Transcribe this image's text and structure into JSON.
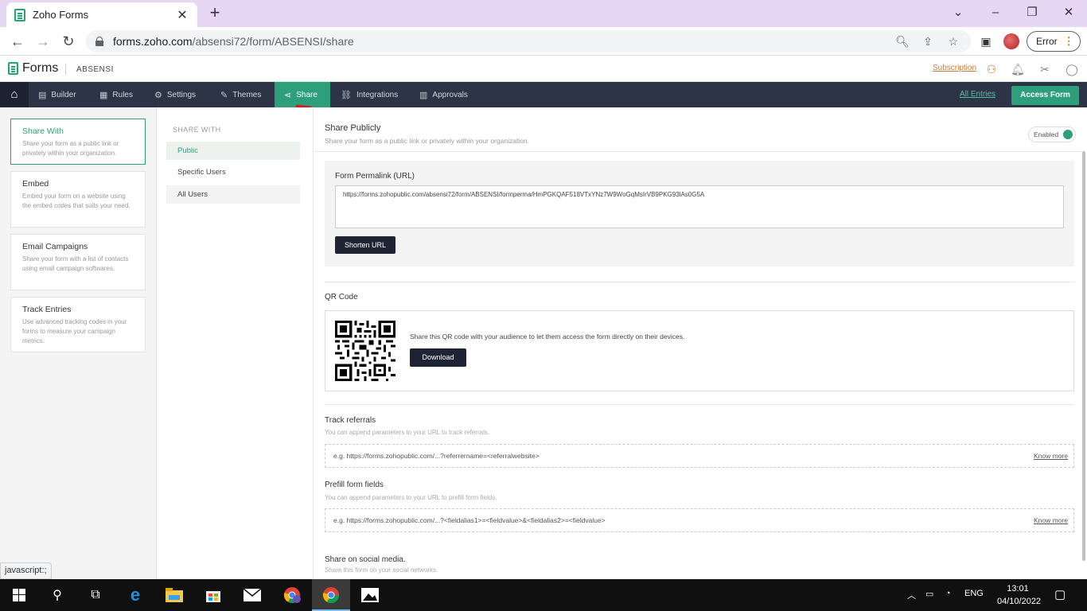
{
  "browser": {
    "tab_title": "Zoho Forms",
    "url_host": "forms.zoho.com",
    "url_path": "/absensi72/form/ABSENSI/share",
    "profile_button": "Error"
  },
  "app": {
    "brand": "Forms",
    "form_name": "ABSENSI",
    "subscription_link": "Subscription"
  },
  "nav": {
    "items": [
      {
        "label": "Builder",
        "icon": "builder-icon"
      },
      {
        "label": "Rules",
        "icon": "rules-icon"
      },
      {
        "label": "Settings",
        "icon": "gear-icon"
      },
      {
        "label": "Themes",
        "icon": "brush-icon"
      },
      {
        "label": "Share",
        "icon": "share-icon"
      },
      {
        "label": "Integrations",
        "icon": "link-icon"
      },
      {
        "label": "Approvals",
        "icon": "approvals-icon"
      }
    ],
    "active": "Share",
    "all_entries": "All Entries",
    "access_form": "Access Form"
  },
  "left_panel": {
    "cards": [
      {
        "title": "Share With",
        "desc": "Share your form as a public link or privately within your organization."
      },
      {
        "title": "Embed",
        "desc": "Embed your form on a website using the embed codes that suits your need."
      },
      {
        "title": "Email Campaigns",
        "desc": "Share your form with a list of contacts using email campaign softwares."
      },
      {
        "title": "Track Entries",
        "desc": "Use advanced tracking codes in your forms to measure your campaign metrics."
      }
    ]
  },
  "mid_panel": {
    "heading": "SHARE WITH",
    "items": [
      "Public",
      "Specific Users",
      "All Users"
    ]
  },
  "main": {
    "title": "Share Publicly",
    "desc": "Share your form as a public link or privately within your organization.",
    "toggle_label": "Enabled",
    "permalink_label": "Form Permalink (URL)",
    "permalink_url": "https://forms.zohopublic.com/absensi72/form/ABSENSI/formperma/HmPGKQAF518VTxYNz7W9WoGqMsIrVB9PKG93lAs0G5A",
    "shorten_button": "Shorten URL",
    "qr_title": "QR Code",
    "qr_text": "Share this QR code with your audience to let them access the form directly on their devices.",
    "download_button": "Download",
    "track_title": "Track referrals",
    "track_desc": "You can append parameters to your URL to track referrals.",
    "track_example": "e.g. https://forms.zohopublic.com/...?referrername=<referralwebsite>",
    "prefill_title": "Prefill form fields",
    "prefill_desc": "You can append parameters to your URL to prefill form fields.",
    "prefill_example": "e.g. https://forms.zohopublic.com/...?<fieldalias1>=<fieldvalue>&<fieldalias2>=<fieldvalue>",
    "know_more": "Know more",
    "social_title": "Share on social media.",
    "social_desc": "Share this form on your social networks."
  },
  "status_bar": "javascript:;",
  "taskbar": {
    "lang": "ENG",
    "time": "13:01",
    "date": "04/10/2022"
  }
}
